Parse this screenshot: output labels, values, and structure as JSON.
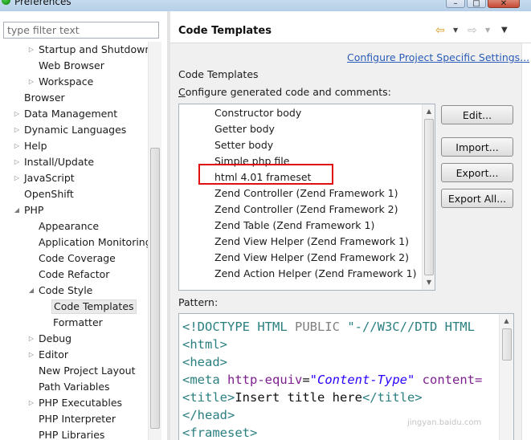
{
  "window": {
    "title": "Preferences"
  },
  "filter": {
    "placeholder": "type filter text"
  },
  "tree": {
    "items": [
      {
        "label": "Startup and Shutdown",
        "expander": "collapsed"
      },
      {
        "label": "Web Browser",
        "expander": "none"
      },
      {
        "label": "Workspace",
        "expander": "collapsed"
      },
      {
        "label": "Browser",
        "expander": "none"
      },
      {
        "label": "Data Management",
        "expander": "collapsed"
      },
      {
        "label": "Dynamic Languages",
        "expander": "collapsed"
      },
      {
        "label": "Help",
        "expander": "collapsed"
      },
      {
        "label": "Install/Update",
        "expander": "collapsed"
      },
      {
        "label": "JavaScript",
        "expander": "collapsed"
      },
      {
        "label": "OpenShift",
        "expander": "none"
      },
      {
        "label": "PHP",
        "expander": "expanded"
      },
      {
        "label": "Appearance",
        "expander": "none"
      },
      {
        "label": "Application Monitoring",
        "expander": "none"
      },
      {
        "label": "Code Coverage",
        "expander": "none"
      },
      {
        "label": "Code Refactor",
        "expander": "none"
      },
      {
        "label": "Code Style",
        "expander": "expanded"
      },
      {
        "label": "Code Templates",
        "expander": "none",
        "selected": true
      },
      {
        "label": "Formatter",
        "expander": "none"
      },
      {
        "label": "Debug",
        "expander": "collapsed"
      },
      {
        "label": "Editor",
        "expander": "collapsed"
      },
      {
        "label": "New Project Layout",
        "expander": "none"
      },
      {
        "label": "Path Variables",
        "expander": "none"
      },
      {
        "label": "PHP Executables",
        "expander": "collapsed"
      },
      {
        "label": "PHP Interpreter",
        "expander": "none"
      },
      {
        "label": "PHP Libraries",
        "expander": "none"
      }
    ]
  },
  "page": {
    "title": "Code Templates",
    "configure_link": "Configure Project Specific Settings...",
    "section_label": "Code Templates",
    "section_desc": "Configure generated code and comments:",
    "pattern_label": "Pattern:"
  },
  "templates": {
    "items": [
      "Constructor body",
      "Getter body",
      "Setter body",
      "Simple php file",
      "html 4.01 frameset",
      "Zend Controller (Zend Framework 1)",
      "Zend Controller (Zend Framework 2)",
      "Zend Table (Zend Framework 1)",
      "Zend View Helper (Zend Framework 1)",
      "Zend View Helper (Zend Framework 2)",
      "Zend Action Helper (Zend Framework 1)"
    ],
    "selected": "html 4.01 frameset"
  },
  "buttons": {
    "edit": "Edit...",
    "import": "Import...",
    "export": "Export...",
    "export_all": "Export All..."
  },
  "pattern": {
    "line1_open": "<!DOCTYPE HTML ",
    "line1_public": "PUBLIC ",
    "line1_string": "\"-//W3C//DTD HTML",
    "line2": "<html>",
    "line3": "<head>",
    "line4_tag": "<meta ",
    "line4_attr": "http-equiv",
    "line4_eq": "=",
    "line4_val": "\"Content-Type\"",
    "line4_attr2": " content=",
    "line5_open": "<title>",
    "line5_text": "Insert title here",
    "line5_close": "</title>",
    "line6": "</head>",
    "line7": "<frameset>"
  },
  "watermark": "jingyan.baidu.com",
  "colors": {
    "highlight_box": "#e01010",
    "link": "#2a5bb8",
    "tag": "#2a7f80",
    "attr": "#7e1f8f",
    "string": "#2a00ff"
  },
  "icons": {
    "back": "left-arrow-icon",
    "forward": "right-arrow-icon",
    "menu": "view-menu-icon"
  }
}
